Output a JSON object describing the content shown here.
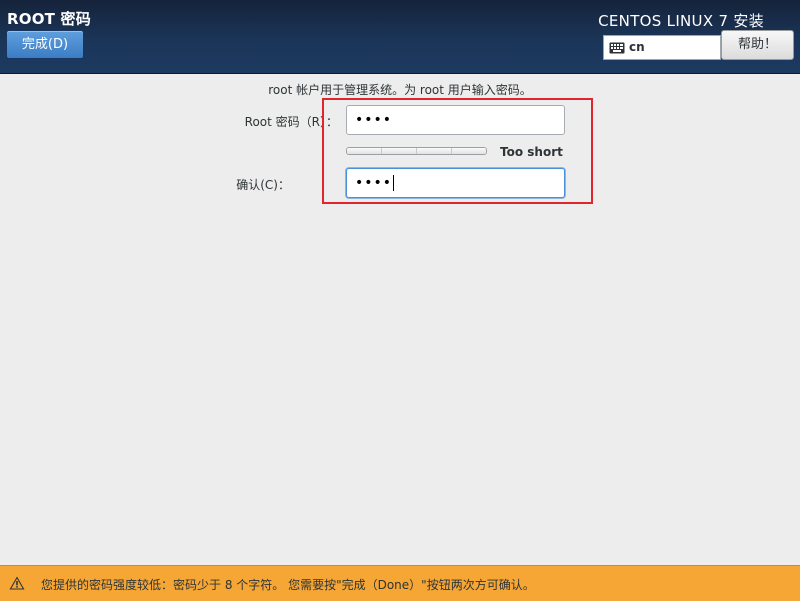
{
  "header": {
    "title": "ROOT 密码",
    "done_label": "完成(D)",
    "product_title": "CENTOS LINUX 7 安装",
    "keyboard": {
      "icon": "keyboard-icon",
      "layout": "cn"
    },
    "help_label": "帮助！"
  },
  "main": {
    "instruction": "root 帐户用于管理系统。为 root 用户输入密码。",
    "root_password": {
      "label": "Root 密码（R）：",
      "value": "••••"
    },
    "strength": {
      "text": "Too short",
      "level": 0
    },
    "confirm_password": {
      "label": "确认(C)：",
      "value": "••••"
    }
  },
  "warning": {
    "icon": "warning-icon",
    "text": "您提供的密码强度较低：密码少于 8 个字符。 您需要按\"完成（Done）\"按钮两次方可确认。"
  },
  "colors": {
    "header_bg": "#1b3558",
    "done_button": "#3b7dc4",
    "warning_bg": "#f6a634",
    "highlight": "#e0262c"
  }
}
